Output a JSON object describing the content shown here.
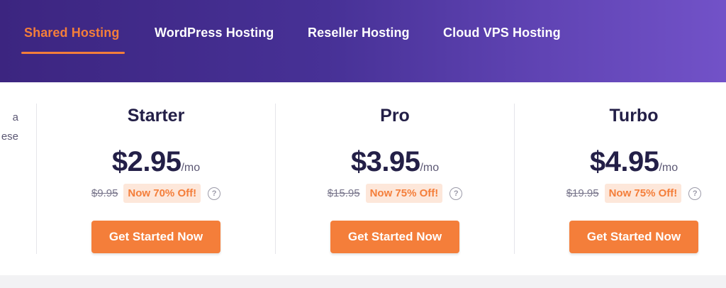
{
  "tabs": [
    {
      "label": "Shared Hosting",
      "active": true
    },
    {
      "label": "WordPress Hosting",
      "active": false
    },
    {
      "label": "Reseller Hosting",
      "active": false
    },
    {
      "label": "Cloud VPS Hosting",
      "active": false
    }
  ],
  "partial_text": [
    "a",
    "ese"
  ],
  "plans": [
    {
      "name": "Starter",
      "price": "$2.95",
      "period": "/mo",
      "old_price": "$9.95",
      "discount": "Now 70% Off!",
      "cta": "Get Started Now"
    },
    {
      "name": "Pro",
      "price": "$3.95",
      "period": "/mo",
      "old_price": "$15.95",
      "discount": "Now 75% Off!",
      "cta": "Get Started Now"
    },
    {
      "name": "Turbo",
      "price": "$4.95",
      "period": "/mo",
      "old_price": "$19.95",
      "discount": "Now 75% Off!",
      "cta": "Get Started Now"
    }
  ],
  "help_icon_glyph": "?",
  "colors": {
    "accent": "#f47e3a",
    "header_start": "#3c2580",
    "header_end": "#7252c8",
    "heading": "#231f47",
    "badge_bg": "#fde7da"
  }
}
